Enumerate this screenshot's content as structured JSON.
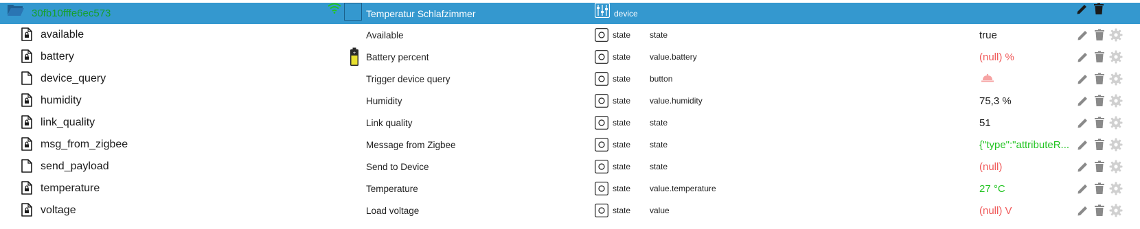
{
  "device": {
    "id": "30fb10fffe6ec573",
    "name": "Temperatur Schlafzimmer",
    "type": "device",
    "icons": {
      "folder": "folder-open-icon",
      "signal": "wifi-icon",
      "type": "sliders-icon",
      "edit": "pencil-icon",
      "delete": "trash-icon"
    },
    "colors": {
      "header_bg": "#3498cf",
      "id_color": "#15a02a"
    }
  },
  "states": [
    {
      "id": "available",
      "name": "Available",
      "type": "state",
      "role": "state",
      "value": "true",
      "value_style": "normal",
      "locked": true
    },
    {
      "id": "battery",
      "name": "Battery percent",
      "type": "state",
      "role": "value.battery",
      "value": "(null) %",
      "value_style": "red",
      "locked": true,
      "icon": "battery-icon"
    },
    {
      "id": "device_query",
      "name": "Trigger device query",
      "type": "state",
      "role": "button",
      "value": "",
      "value_style": "bell",
      "locked": false,
      "value_icon": "bell-button-icon"
    },
    {
      "id": "humidity",
      "name": "Humidity",
      "type": "state",
      "role": "value.humidity",
      "value": "75,3 %",
      "value_style": "normal",
      "locked": true
    },
    {
      "id": "link_quality",
      "name": "Link quality",
      "type": "state",
      "role": "state",
      "value": "51",
      "value_style": "normal",
      "locked": true
    },
    {
      "id": "msg_from_zigbee",
      "name": "Message from Zigbee",
      "type": "state",
      "role": "state",
      "value": "{\"type\":\"attributeR...",
      "value_style": "green",
      "locked": true
    },
    {
      "id": "send_payload",
      "name": "Send to Device",
      "type": "state",
      "role": "state",
      "value": "(null)",
      "value_style": "red",
      "locked": false
    },
    {
      "id": "temperature",
      "name": "Temperature",
      "type": "state",
      "role": "value.temperature",
      "value": "27 °C",
      "value_style": "green",
      "locked": true
    },
    {
      "id": "voltage",
      "name": "Load voltage",
      "type": "state",
      "role": "value",
      "value": "(null) V",
      "value_style": "red",
      "locked": true
    }
  ],
  "colors": {
    "value_red": "#f05a5a",
    "value_green": "#22c422",
    "action_icon": "#8a8a8a"
  }
}
